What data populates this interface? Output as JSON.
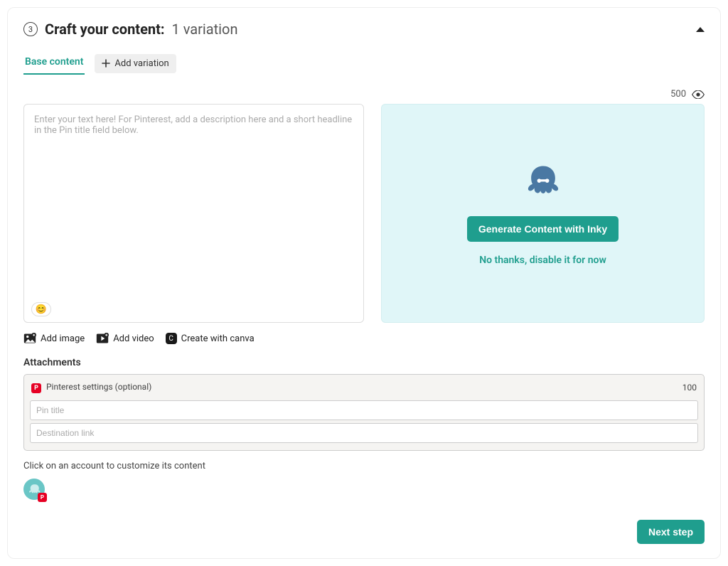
{
  "step": {
    "number": "3",
    "title": "Craft your content:",
    "subtitle": "1 variation"
  },
  "tabs": {
    "base": "Base content",
    "addVariation": "Add variation"
  },
  "charCount": {
    "main": "500"
  },
  "editor": {
    "placeholder": "Enter your text here! For Pinterest, add a description here and a short headline in the Pin title field below."
  },
  "inky": {
    "generate": "Generate Content with Inky",
    "disable": "No thanks, disable it for now"
  },
  "media": {
    "addImage": "Add image",
    "addVideo": "Add video",
    "canva": "Create with canva"
  },
  "attachments": {
    "title": "Attachments",
    "settingsHeader": "Pinterest settings (optional)",
    "pinCharCount": "100",
    "pinTitlePlaceholder": "Pin title",
    "destLinkPlaceholder": "Destination link"
  },
  "hint": "Click on an account to customize its content",
  "footer": {
    "next": "Next step"
  }
}
